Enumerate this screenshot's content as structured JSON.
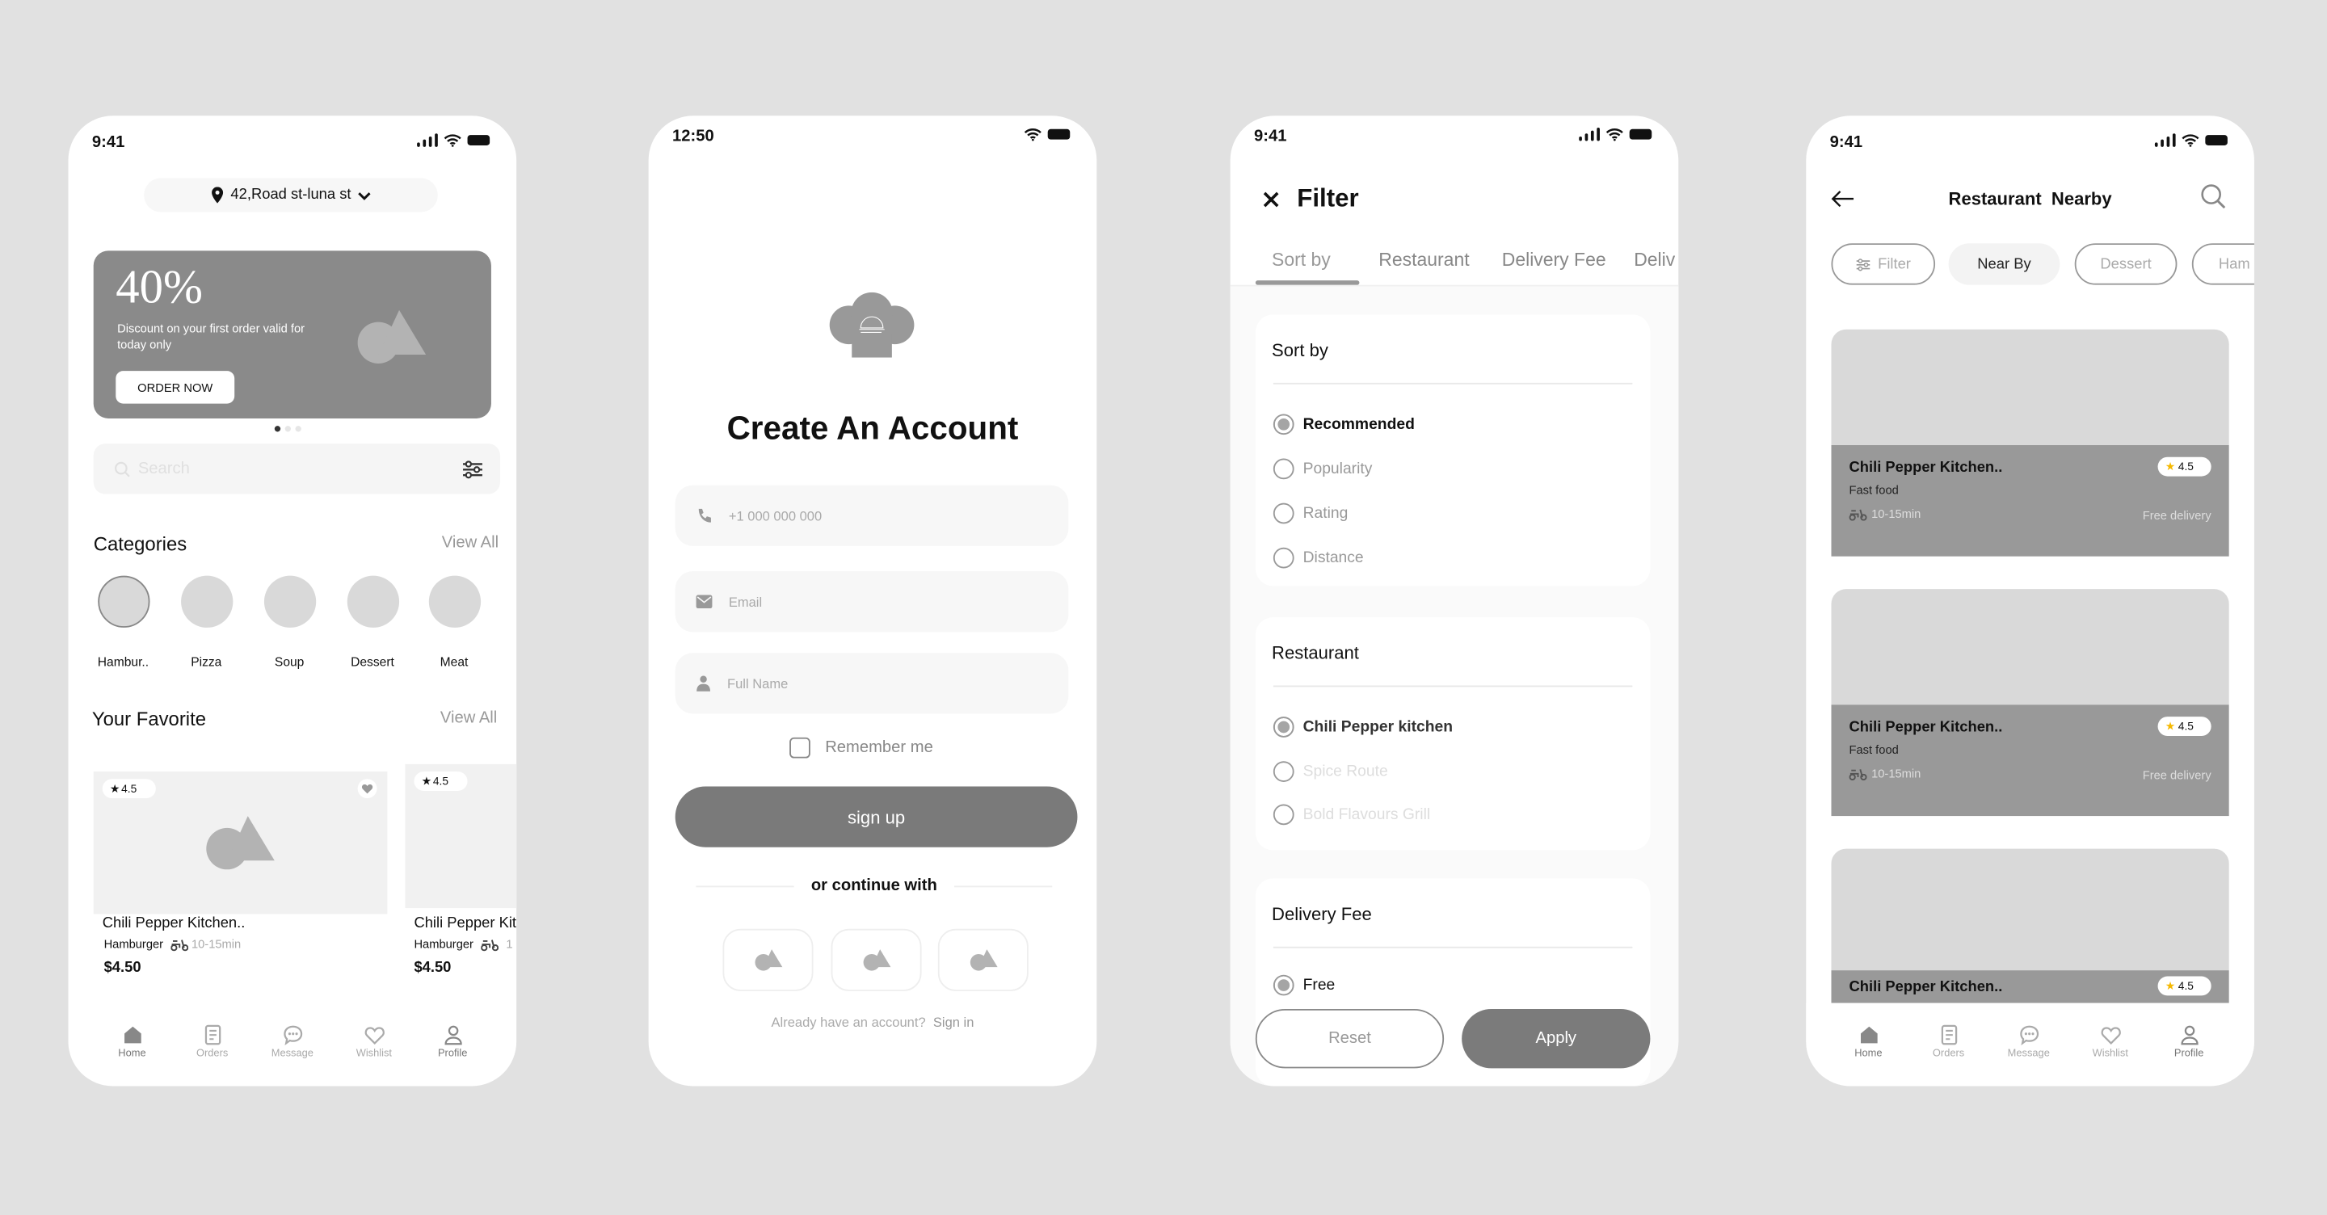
{
  "status": {
    "time_a": "9:41",
    "time_b": "12:50"
  },
  "home": {
    "location": "42,Road st-luna st",
    "banner": {
      "percent": "40%",
      "text": "Discount on your first order valid for today only",
      "button": "ORDER NOW"
    },
    "search_placeholder": "Search",
    "categories_title": "Categories",
    "view_all": "View All",
    "categories": [
      "Hambur..",
      "Pizza",
      "Soup",
      "Dessert",
      "Meat"
    ],
    "favorite_title": "Your Favorite",
    "favorites": [
      {
        "rating": "4.5",
        "name": "Chili Pepper Kitchen..",
        "category": "Hamburger",
        "time": "10-15min",
        "price": "$4.50"
      },
      {
        "rating": "4.5",
        "name": "Chili Pepper Kit",
        "category": "Hamburger",
        "time": "1",
        "price": "$4.50"
      }
    ]
  },
  "nav": [
    "Home",
    "Orders",
    "Message",
    "Wishlist",
    "Profile"
  ],
  "signup": {
    "title": "Create An Account",
    "phone_placeholder": "+1 000 000 000",
    "email_placeholder": "Email",
    "name_placeholder": "Full Name",
    "remember": "Remember me",
    "button": "sign up",
    "or": "or continue with",
    "already": "Already have an account?",
    "signin": "Sign in"
  },
  "filter": {
    "title": "Filter",
    "tabs": [
      "Sort by",
      "Restaurant",
      "Delivery Fee",
      "Deliv"
    ],
    "sort_title": "Sort by",
    "sort_options": [
      "Recommended",
      "Popularity",
      "Rating",
      "Distance"
    ],
    "sort_selected": "Recommended",
    "restaurant_title": "Restaurant",
    "restaurant_options": [
      "Chili Pepper kitchen",
      "Spice Route",
      "Bold Flavours Grill"
    ],
    "restaurant_selected": "Chili Pepper kitchen",
    "fee_title": "Delivery Fee",
    "fee_options": [
      "Free"
    ],
    "fee_selected": "Free",
    "reset": "Reset",
    "apply": "Apply"
  },
  "nearby": {
    "title": "Restaurant  Nearby",
    "chips": [
      "Filter",
      "Near By",
      "Dessert",
      "Ham"
    ],
    "chip_selected": "Near By",
    "restaurants": [
      {
        "name": "Chili Pepper Kitchen..",
        "category": "Fast food",
        "time": "10-15min",
        "delivery": "Free delivery",
        "rating": "4.5"
      },
      {
        "name": "Chili Pepper Kitchen..",
        "category": "Fast food",
        "time": "10-15min",
        "delivery": "Free delivery",
        "rating": "4.5"
      },
      {
        "name": "Chili Pepper Kitchen..",
        "rating": "4.5"
      }
    ]
  },
  "colors": {
    "background": "#e1e1e1",
    "primary_button": "#7a7a7a",
    "banner": "#8a8a8a",
    "star": "#f5b800"
  }
}
